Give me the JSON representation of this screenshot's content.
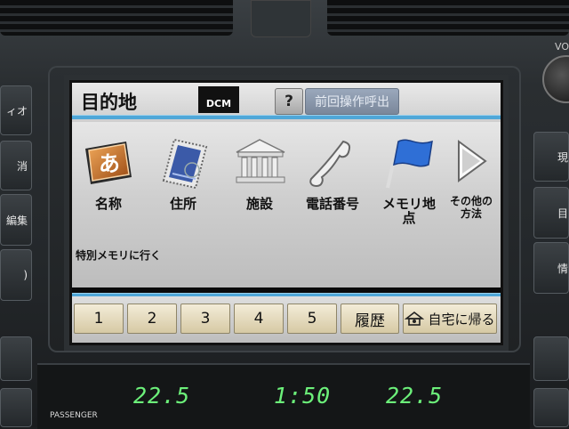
{
  "header": {
    "title": "目的地",
    "dcm_label": "DCM",
    "help_label": "?",
    "recall_label": "前回操作呼出"
  },
  "menu": {
    "items": [
      {
        "label": "名称",
        "icon": "kana-a-icon"
      },
      {
        "label": "住所",
        "icon": "stamp-icon"
      },
      {
        "label": "施設",
        "icon": "building-icon"
      },
      {
        "label": "電話番号",
        "icon": "phone-icon"
      },
      {
        "label": "メモリ地点",
        "icon": "flag-icon"
      },
      {
        "label": "その他の方法",
        "line1": "その他の",
        "line2": "方法",
        "icon": "play-triangle-icon"
      }
    ],
    "kana_glyph": "あ"
  },
  "memory": {
    "label": "特別メモリに行く",
    "buttons": [
      "1",
      "2",
      "3",
      "4",
      "5"
    ],
    "history_label": "履歴",
    "home_label": "自宅に帰る"
  },
  "side_buttons": {
    "left": [
      "ィオ",
      "消",
      "編集",
      ")"
    ],
    "right": [
      "現",
      "目",
      "情"
    ]
  },
  "lcd": {
    "left_temp": "22.5",
    "time": "1:50",
    "right_temp": "22.5",
    "passenger_label": "PASSENGER"
  },
  "volume_label": "VO",
  "colors": {
    "accent_line": "#4fa7d8",
    "lcd_green": "#6cf07a",
    "recall_button": "#8a97ab",
    "memory_button": "#e6dcbc"
  }
}
